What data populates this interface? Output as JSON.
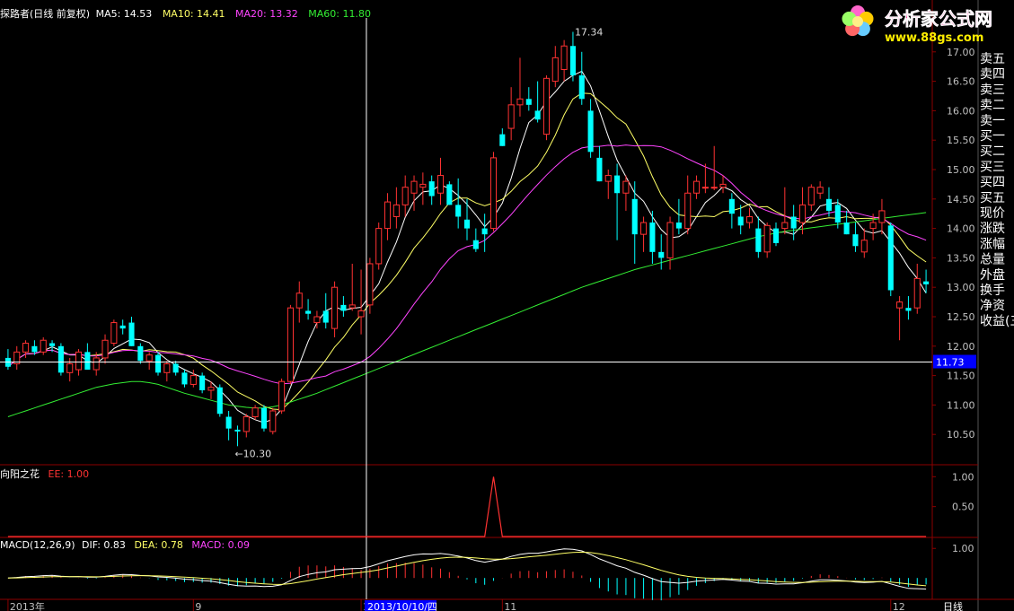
{
  "header": {
    "title": "探路者(日线 前复权)",
    "ma_labels": [
      {
        "text": "MA5: 14.53",
        "color": "#ffffff"
      },
      {
        "text": "MA10: 14.41",
        "color": "#ffff66"
      },
      {
        "text": "MA20: 13.32",
        "color": "#ff44ff"
      },
      {
        "text": "MA60: 11.80",
        "color": "#33ee33"
      }
    ]
  },
  "watermark": {
    "line1": "分析家公式网",
    "line2": "www.88gs.com"
  },
  "side_panel": {
    "items": [
      "卖五",
      "卖四",
      "卖三",
      "卖二",
      "卖一",
      "买一",
      "买二",
      "买三",
      "买四",
      "买五",
      "现价",
      "涨跌",
      "涨幅",
      "总量",
      "外盘",
      "换手",
      "净资",
      "收益(三"
    ]
  },
  "colors": {
    "up": "#ff3232",
    "down": "#00ffff",
    "ma5": "#ffffff",
    "ma10": "#ffff66",
    "ma20": "#ff44ff",
    "ma60": "#33ee33",
    "grid": "#8b0000",
    "axis_text": "#c0c0c0"
  },
  "chart_data": [
    {
      "type": "candlestick",
      "title": "探路者(日线 前复权)",
      "ylim": [
        10.0,
        17.5
      ],
      "y_ticks": [
        "10.50",
        "11.00",
        "11.50",
        "12.00",
        "12.50",
        "13.00",
        "13.50",
        "14.00",
        "14.50",
        "15.00",
        "15.50",
        "16.00",
        "16.50",
        "17.00"
      ],
      "annotations": {
        "high_label": "17.34",
        "low_label": "←10.30",
        "crosshair_price": "11.73"
      },
      "ohlc": [
        [
          11.8,
          11.95,
          11.6,
          11.65
        ],
        [
          11.7,
          12.0,
          11.6,
          11.9
        ],
        [
          11.9,
          12.1,
          11.8,
          12.05
        ],
        [
          12.0,
          12.1,
          11.85,
          11.9
        ],
        [
          11.9,
          12.15,
          11.85,
          12.1
        ],
        [
          12.05,
          12.1,
          11.9,
          12.0
        ],
        [
          12.0,
          12.05,
          11.5,
          11.55
        ],
        [
          11.55,
          11.8,
          11.4,
          11.7
        ],
        [
          11.6,
          11.95,
          11.5,
          11.9
        ],
        [
          11.9,
          12.05,
          11.7,
          11.6
        ],
        [
          11.6,
          11.9,
          11.5,
          11.8
        ],
        [
          11.8,
          12.2,
          11.7,
          12.1
        ],
        [
          12.05,
          12.45,
          12.0,
          12.4
        ],
        [
          12.35,
          12.45,
          12.2,
          12.3
        ],
        [
          12.4,
          12.5,
          12.0,
          12.0
        ],
        [
          12.0,
          12.05,
          11.7,
          11.75
        ],
        [
          11.75,
          11.9,
          11.6,
          11.85
        ],
        [
          11.85,
          11.9,
          11.5,
          11.55
        ],
        [
          11.55,
          11.75,
          11.4,
          11.7
        ],
        [
          11.7,
          11.75,
          11.5,
          11.55
        ],
        [
          11.55,
          11.6,
          11.3,
          11.35
        ],
        [
          11.35,
          11.6,
          11.3,
          11.5
        ],
        [
          11.5,
          11.55,
          11.2,
          11.25
        ],
        [
          11.25,
          11.4,
          11.1,
          11.3
        ],
        [
          11.3,
          11.35,
          10.8,
          10.85
        ],
        [
          10.8,
          10.9,
          10.4,
          10.6
        ],
        [
          10.58,
          10.65,
          10.3,
          10.55
        ],
        [
          10.55,
          10.85,
          10.45,
          10.8
        ],
        [
          10.8,
          11.0,
          10.75,
          10.95
        ],
        [
          10.95,
          11.0,
          10.55,
          10.6
        ],
        [
          10.55,
          10.95,
          10.5,
          10.9
        ],
        [
          10.9,
          11.45,
          10.85,
          11.4
        ],
        [
          11.4,
          12.7,
          11.35,
          12.65
        ],
        [
          12.65,
          13.1,
          12.4,
          12.9
        ],
        [
          12.6,
          12.8,
          12.45,
          12.55
        ],
        [
          12.4,
          12.6,
          12.3,
          12.5
        ],
        [
          12.6,
          12.9,
          12.3,
          12.4
        ],
        [
          12.3,
          13.1,
          12.15,
          13.0
        ],
        [
          12.7,
          12.85,
          12.5,
          12.6
        ],
        [
          12.65,
          13.4,
          12.6,
          12.7
        ],
        [
          12.5,
          13.3,
          12.2,
          12.6
        ],
        [
          12.7,
          13.5,
          12.55,
          13.4
        ],
        [
          13.4,
          14.1,
          13.3,
          14.0
        ],
        [
          14.0,
          14.6,
          13.8,
          14.45
        ],
        [
          14.2,
          14.7,
          14.0,
          14.4
        ],
        [
          14.4,
          14.9,
          14.2,
          14.7
        ],
        [
          14.6,
          14.9,
          14.3,
          14.8
        ],
        [
          14.7,
          14.95,
          14.4,
          14.75
        ],
        [
          14.8,
          14.9,
          14.4,
          14.55
        ],
        [
          14.6,
          15.2,
          14.4,
          14.9
        ],
        [
          14.75,
          14.8,
          14.4,
          14.4
        ],
        [
          14.4,
          14.85,
          14.0,
          14.2
        ],
        [
          14.15,
          14.5,
          13.8,
          14.0
        ],
        [
          13.8,
          14.0,
          13.6,
          13.65
        ],
        [
          14.0,
          14.25,
          13.6,
          13.9
        ],
        [
          14.0,
          15.3,
          13.95,
          15.2
        ],
        [
          15.6,
          15.7,
          15.4,
          15.4
        ],
        [
          15.7,
          16.4,
          15.5,
          16.1
        ],
        [
          16.1,
          16.9,
          15.9,
          16.2
        ],
        [
          16.2,
          16.4,
          16.0,
          16.1
        ],
        [
          16.0,
          16.5,
          15.8,
          15.85
        ],
        [
          15.6,
          16.6,
          15.5,
          16.55
        ],
        [
          16.5,
          17.1,
          16.4,
          16.9
        ],
        [
          16.7,
          17.2,
          16.5,
          17.1
        ],
        [
          17.1,
          17.34,
          16.5,
          16.6
        ],
        [
          16.6,
          17.0,
          16.1,
          16.2
        ],
        [
          16.0,
          16.2,
          15.2,
          15.3
        ],
        [
          15.2,
          15.4,
          14.8,
          14.8
        ],
        [
          14.8,
          15.0,
          14.5,
          14.9
        ],
        [
          14.9,
          15.1,
          13.8,
          14.6
        ],
        [
          14.6,
          14.9,
          14.3,
          14.8
        ],
        [
          14.5,
          14.8,
          13.4,
          13.9
        ],
        [
          13.9,
          14.2,
          13.6,
          14.1
        ],
        [
          14.1,
          14.3,
          13.4,
          13.6
        ],
        [
          13.6,
          13.9,
          13.3,
          13.5
        ],
        [
          13.5,
          14.2,
          13.3,
          14.1
        ],
        [
          14.1,
          14.5,
          13.9,
          14.0
        ],
        [
          14.0,
          14.9,
          13.9,
          14.6
        ],
        [
          14.6,
          14.9,
          14.5,
          14.8
        ],
        [
          14.7,
          15.1,
          14.6,
          14.7
        ],
        [
          14.7,
          15.4,
          14.65,
          14.7
        ],
        [
          14.7,
          14.9,
          14.6,
          14.75
        ],
        [
          14.5,
          14.6,
          14.0,
          14.25
        ],
        [
          14.2,
          14.4,
          13.9,
          14.05
        ],
        [
          14.1,
          14.35,
          14.0,
          14.2
        ],
        [
          14.0,
          14.2,
          13.5,
          13.6
        ],
        [
          13.6,
          14.1,
          13.5,
          14.05
        ],
        [
          14.0,
          14.1,
          13.7,
          13.75
        ],
        [
          14.0,
          14.7,
          13.9,
          14.1
        ],
        [
          14.2,
          14.4,
          13.8,
          14.0
        ],
        [
          14.1,
          14.7,
          13.9,
          14.4
        ],
        [
          14.4,
          14.75,
          14.3,
          14.7
        ],
        [
          14.6,
          14.8,
          14.5,
          14.7
        ],
        [
          14.5,
          14.7,
          14.2,
          14.3
        ],
        [
          14.4,
          14.5,
          14.0,
          14.1
        ],
        [
          14.1,
          14.3,
          13.9,
          13.9
        ],
        [
          13.9,
          14.1,
          13.6,
          13.7
        ],
        [
          13.6,
          14.0,
          13.5,
          13.8
        ],
        [
          14.0,
          14.25,
          13.8,
          14.1
        ],
        [
          14.1,
          14.5,
          13.9,
          14.3
        ],
        [
          14.05,
          14.1,
          12.85,
          12.95
        ],
        [
          12.65,
          12.85,
          12.1,
          12.75
        ],
        [
          12.65,
          12.85,
          12.45,
          12.6
        ],
        [
          12.65,
          13.4,
          12.55,
          13.15
        ],
        [
          13.1,
          13.3,
          12.9,
          13.05
        ]
      ],
      "ma_series": [
        {
          "name": "MA5"
        },
        {
          "name": "MA10"
        },
        {
          "name": "MA20"
        },
        {
          "name": "MA60",
          "values": [
            10.8,
            10.85,
            10.9,
            10.95,
            11.0,
            11.05,
            11.1,
            11.15,
            11.2,
            11.25,
            11.3,
            11.33,
            11.36,
            11.38,
            11.4,
            11.4,
            11.38,
            11.35,
            11.3,
            11.25,
            11.2,
            11.16,
            11.12,
            11.08,
            11.04,
            11.0,
            10.98,
            10.96,
            10.95,
            10.95,
            10.97,
            11.0,
            11.05,
            11.1,
            11.15,
            11.2,
            11.26,
            11.32,
            11.38,
            11.44,
            11.5,
            11.56,
            11.62,
            11.68,
            11.74,
            11.8,
            11.86,
            11.92,
            11.98,
            12.04,
            12.1,
            12.16,
            12.22,
            12.28,
            12.34,
            12.4,
            12.46,
            12.52,
            12.58,
            12.64,
            12.7,
            12.76,
            12.82,
            12.88,
            12.94,
            13.0,
            13.05,
            13.1,
            13.15,
            13.2,
            13.25,
            13.3,
            13.34,
            13.38,
            13.42,
            13.46,
            13.5,
            13.54,
            13.58,
            13.62,
            13.66,
            13.7,
            13.74,
            13.78,
            13.82,
            13.86,
            13.89,
            13.92,
            13.95,
            13.97,
            13.99,
            14.01,
            14.03,
            14.05,
            14.07,
            14.09,
            14.11,
            14.13,
            14.15,
            14.17,
            14.19,
            14.21,
            14.23,
            14.25,
            14.27
          ]
        }
      ]
    },
    {
      "type": "line",
      "title": "向阳之花",
      "series": [
        {
          "name": "EE",
          "last": "1.00",
          "values": [
            0,
            0,
            0,
            0,
            0,
            0,
            0,
            0,
            0,
            0,
            0,
            0,
            0,
            0,
            0,
            0,
            0,
            0,
            0,
            0,
            0,
            0,
            0,
            0,
            0,
            0,
            0,
            0,
            0,
            0,
            0,
            0,
            0,
            0,
            0,
            0,
            0,
            0,
            0,
            0,
            0,
            0,
            0,
            0,
            0,
            0,
            0,
            0,
            0,
            0,
            0,
            0,
            0,
            0,
            0,
            1,
            0,
            0,
            0,
            0,
            0,
            0,
            0,
            0,
            0,
            0,
            0,
            0,
            0,
            0,
            0,
            0,
            0,
            0,
            0,
            0,
            0,
            0,
            0,
            0,
            0,
            0,
            0,
            0,
            0,
            0,
            0,
            0,
            0,
            0,
            0,
            0,
            0,
            0,
            0,
            0,
            0,
            0,
            0,
            0,
            0,
            0,
            0,
            0,
            0
          ]
        }
      ],
      "ylim": [
        0,
        1.2
      ],
      "y_ticks": [
        "0.50",
        "1.00"
      ]
    },
    {
      "type": "macd",
      "title": "MACD(12,26,9)",
      "labels": {
        "dif": "DIF: 0.83",
        "dea": "DEA: 0.78",
        "macd": "MACD: 0.09"
      },
      "ylim": [
        -0.6,
        1.25
      ],
      "y_ticks": [
        "1.00"
      ]
    }
  ],
  "x_axis": {
    "labels": [
      {
        "text": "2013年",
        "index": 0
      },
      {
        "text": "9",
        "index": 21
      },
      {
        "text": "10",
        "index": 40
      },
      {
        "text": "11",
        "index": 56
      },
      {
        "text": "12",
        "index": 100
      }
    ],
    "cursor_date": "2013/10/10/四",
    "period": "日线"
  }
}
